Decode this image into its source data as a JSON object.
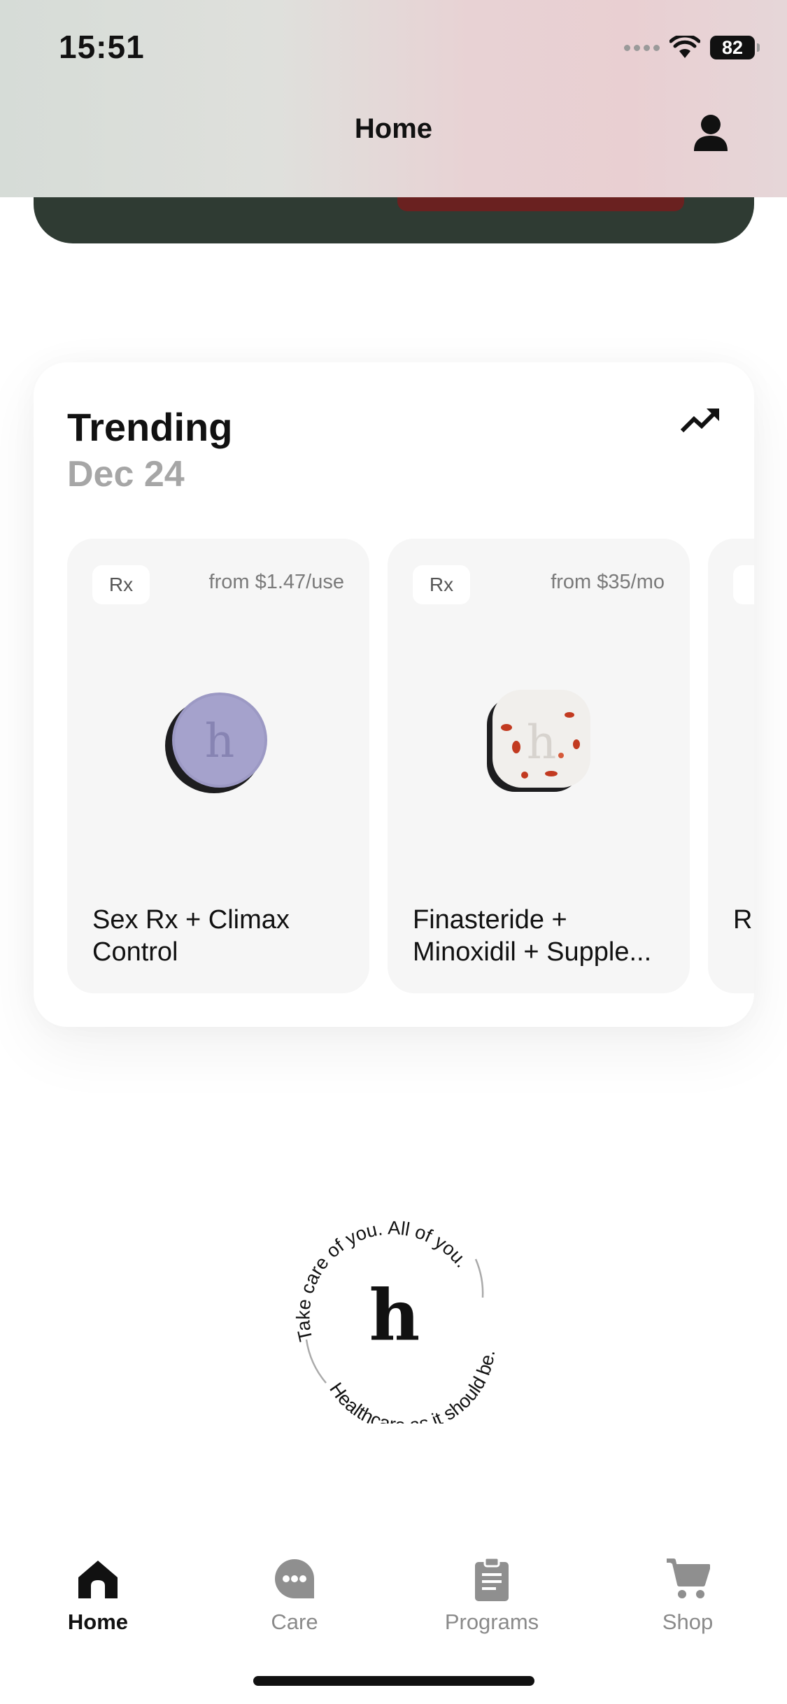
{
  "status_bar": {
    "time": "15:51",
    "battery": "82"
  },
  "nav": {
    "title": "Home"
  },
  "trending": {
    "title": "Trending",
    "date": "Dec 24",
    "products": [
      {
        "badge": "Rx",
        "price": "from $1.47/use",
        "name": "Sex Rx + Climax Control",
        "pill_color": "#9c99c4"
      },
      {
        "badge": "Rx",
        "price": "from $35/mo",
        "name": "Finasteride + Minoxidil + Supple...",
        "pill_color": "#f1efec"
      },
      {
        "badge": "",
        "price": "",
        "name": "R"
      }
    ]
  },
  "brand": {
    "logo_letter": "h",
    "ring_top": "Take care of you. All of you.",
    "ring_bottom": "Healthcare as it should be."
  },
  "tabs": [
    {
      "label": "Home",
      "icon": "home-icon",
      "active": true
    },
    {
      "label": "Care",
      "icon": "chat-bubble-icon",
      "active": false
    },
    {
      "label": "Programs",
      "icon": "clipboard-icon",
      "active": false
    },
    {
      "label": "Shop",
      "icon": "cart-icon",
      "active": false
    }
  ],
  "colors": {
    "dark_banner": "#2f3b33",
    "card_bg": "#f6f6f6"
  }
}
